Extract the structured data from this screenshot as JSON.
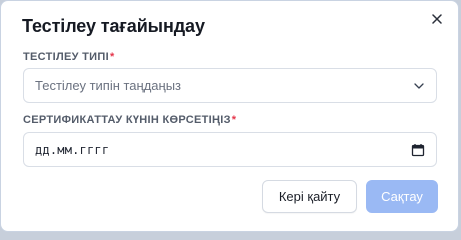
{
  "dialog": {
    "title": "Тестілеу тағайындау"
  },
  "fields": {
    "test_type": {
      "label": "ТЕСТІЛЕУ ТИПІ",
      "required_mark": "*",
      "placeholder": "Тестілеу типін таңдаңыз"
    },
    "cert_date": {
      "label": "СЕРТИФИКАТТАУ КҮНІН КӨРСЕТІҢІЗ",
      "required_mark": "*",
      "value": "дд.мм.гггг"
    }
  },
  "buttons": {
    "back_label": "Кері қайту",
    "save_label": "Сақтау"
  },
  "icons": {
    "close": "close-icon",
    "chevron": "chevron-down-icon",
    "calendar": "calendar-icon"
  },
  "colors": {
    "required": "#e5364b",
    "primary_disabled": "#9ab9f4"
  }
}
